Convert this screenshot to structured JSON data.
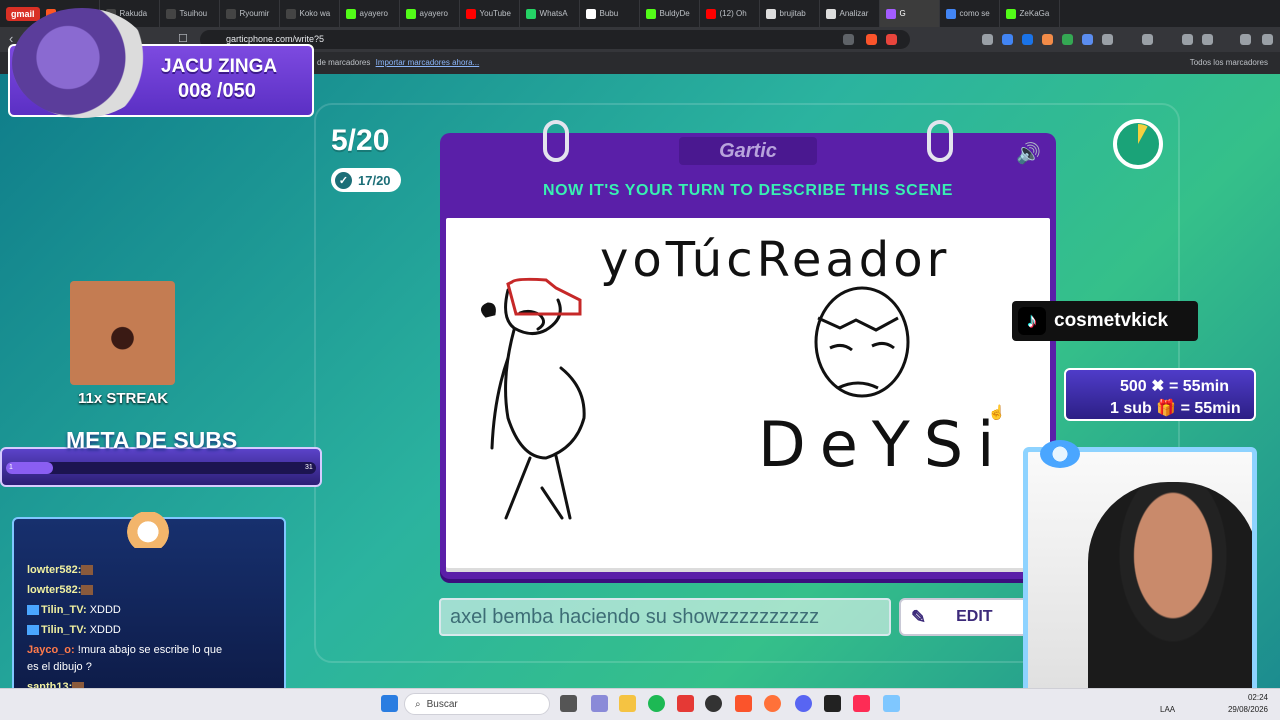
{
  "browser": {
    "gmail_label": "gmail",
    "tabs": [
      {
        "label": "",
        "color": "#ff5722"
      },
      {
        "label": "Rakuda",
        "color": "#444"
      },
      {
        "label": "Tsuihou",
        "color": "#444"
      },
      {
        "label": "Ryoumir",
        "color": "#444"
      },
      {
        "label": "Koko wa",
        "color": "#444"
      },
      {
        "label": "ayayero",
        "color": "#53fc18"
      },
      {
        "label": "ayayero",
        "color": "#53fc18"
      },
      {
        "label": "YouTube",
        "color": "#ff0000"
      },
      {
        "label": "WhatsA",
        "color": "#25d366"
      },
      {
        "label": "Bubu",
        "color": "#fff"
      },
      {
        "label": "BuldyDe",
        "color": "#53fc18"
      },
      {
        "label": "(12) Oh",
        "color": "#ff0000"
      },
      {
        "label": "brujitab",
        "color": "#ddd"
      },
      {
        "label": "Analizar",
        "color": "#ddd"
      },
      {
        "label": "G",
        "color": "#a35cff",
        "active": true
      },
      {
        "label": "como se",
        "color": "#4285f4"
      },
      {
        "label": "ZeKaGa",
        "color": "#53fc18"
      }
    ],
    "url": "garticphone.com/write?5",
    "bookmarks_text": "de marcadores",
    "bookmarks_import": "Importar marcadores ahora...",
    "bookmarks_all": "Todos los marcadores"
  },
  "game": {
    "round": "5/20",
    "done_count": "17/20",
    "logo": "Gartic",
    "instruction": "NOW IT'S YOUR TURN TO DESCRIBE THIS SCENE",
    "drawing_text_top": "yoTúcReador",
    "drawing_text_bottom": "DeYSi",
    "description_value": "axel bemba haciendo su showzzzzzzzzzz",
    "edit_label": "EDIT",
    "timer_progress": 0.08
  },
  "overlay": {
    "alert_name": "JACU ZINGA",
    "alert_count": "008 /050",
    "streak": "11x STREAK",
    "meta_title": "META DE SUBS",
    "meta_min": "1",
    "meta_max": "31",
    "meta_progress": 0.15,
    "tiktok_handle": "cosmetvkick",
    "goal_line1": "500 ✖ = 55min",
    "goal_line2": "1 sub 🎁 = 55min",
    "chat": [
      {
        "user": "lowter582:",
        "msg": ""
      },
      {
        "user": "lowter582:",
        "msg": ""
      },
      {
        "user": "Tilin_TV:",
        "msg": " XDDD"
      },
      {
        "user": "Tilin_TV:",
        "msg": " XDDD"
      },
      {
        "user": "Jayco_o:",
        "msg": " !mura abajo se escribe lo que"
      },
      {
        "user": "",
        "msg": "es el dibujo ?"
      },
      {
        "user": "santh13:",
        "msg": ""
      }
    ]
  },
  "taskbar": {
    "search_placeholder": "Buscar",
    "lang": "LAA",
    "time": "02:24",
    "date": "29/08/2026"
  },
  "colors": {
    "book": "#5a1fa8",
    "instruction": "#39f0b2",
    "game_bg": "#2bb39f"
  }
}
